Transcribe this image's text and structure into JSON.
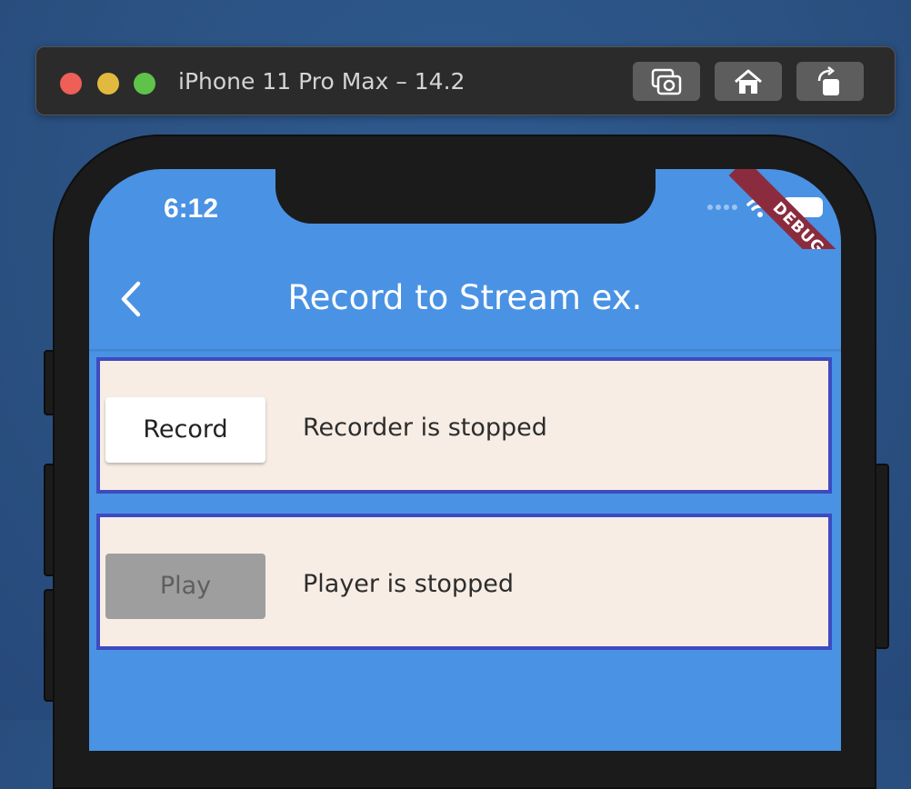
{
  "window": {
    "title": "iPhone 11 Pro Max – 14.2",
    "buttons": [
      "screenshot-icon",
      "home-icon",
      "rotate-icon"
    ]
  },
  "status_bar": {
    "time": "6:12",
    "icons": [
      "signal-icon",
      "wifi-icon",
      "battery-icon"
    ]
  },
  "debug_banner": "DEBUG",
  "appbar": {
    "title": "Record to Stream ex.",
    "back_icon": "chevron-left-icon"
  },
  "recorder": {
    "button_label": "Record",
    "status": "Recorder is stopped"
  },
  "player": {
    "button_label": "Play",
    "status": "Player is stopped",
    "enabled": false
  },
  "colors": {
    "app_blue": "#4a92e4",
    "card_bg": "#f7ede4",
    "card_border": "#3d4bbf",
    "debug_banner": "#8b2c3e"
  }
}
